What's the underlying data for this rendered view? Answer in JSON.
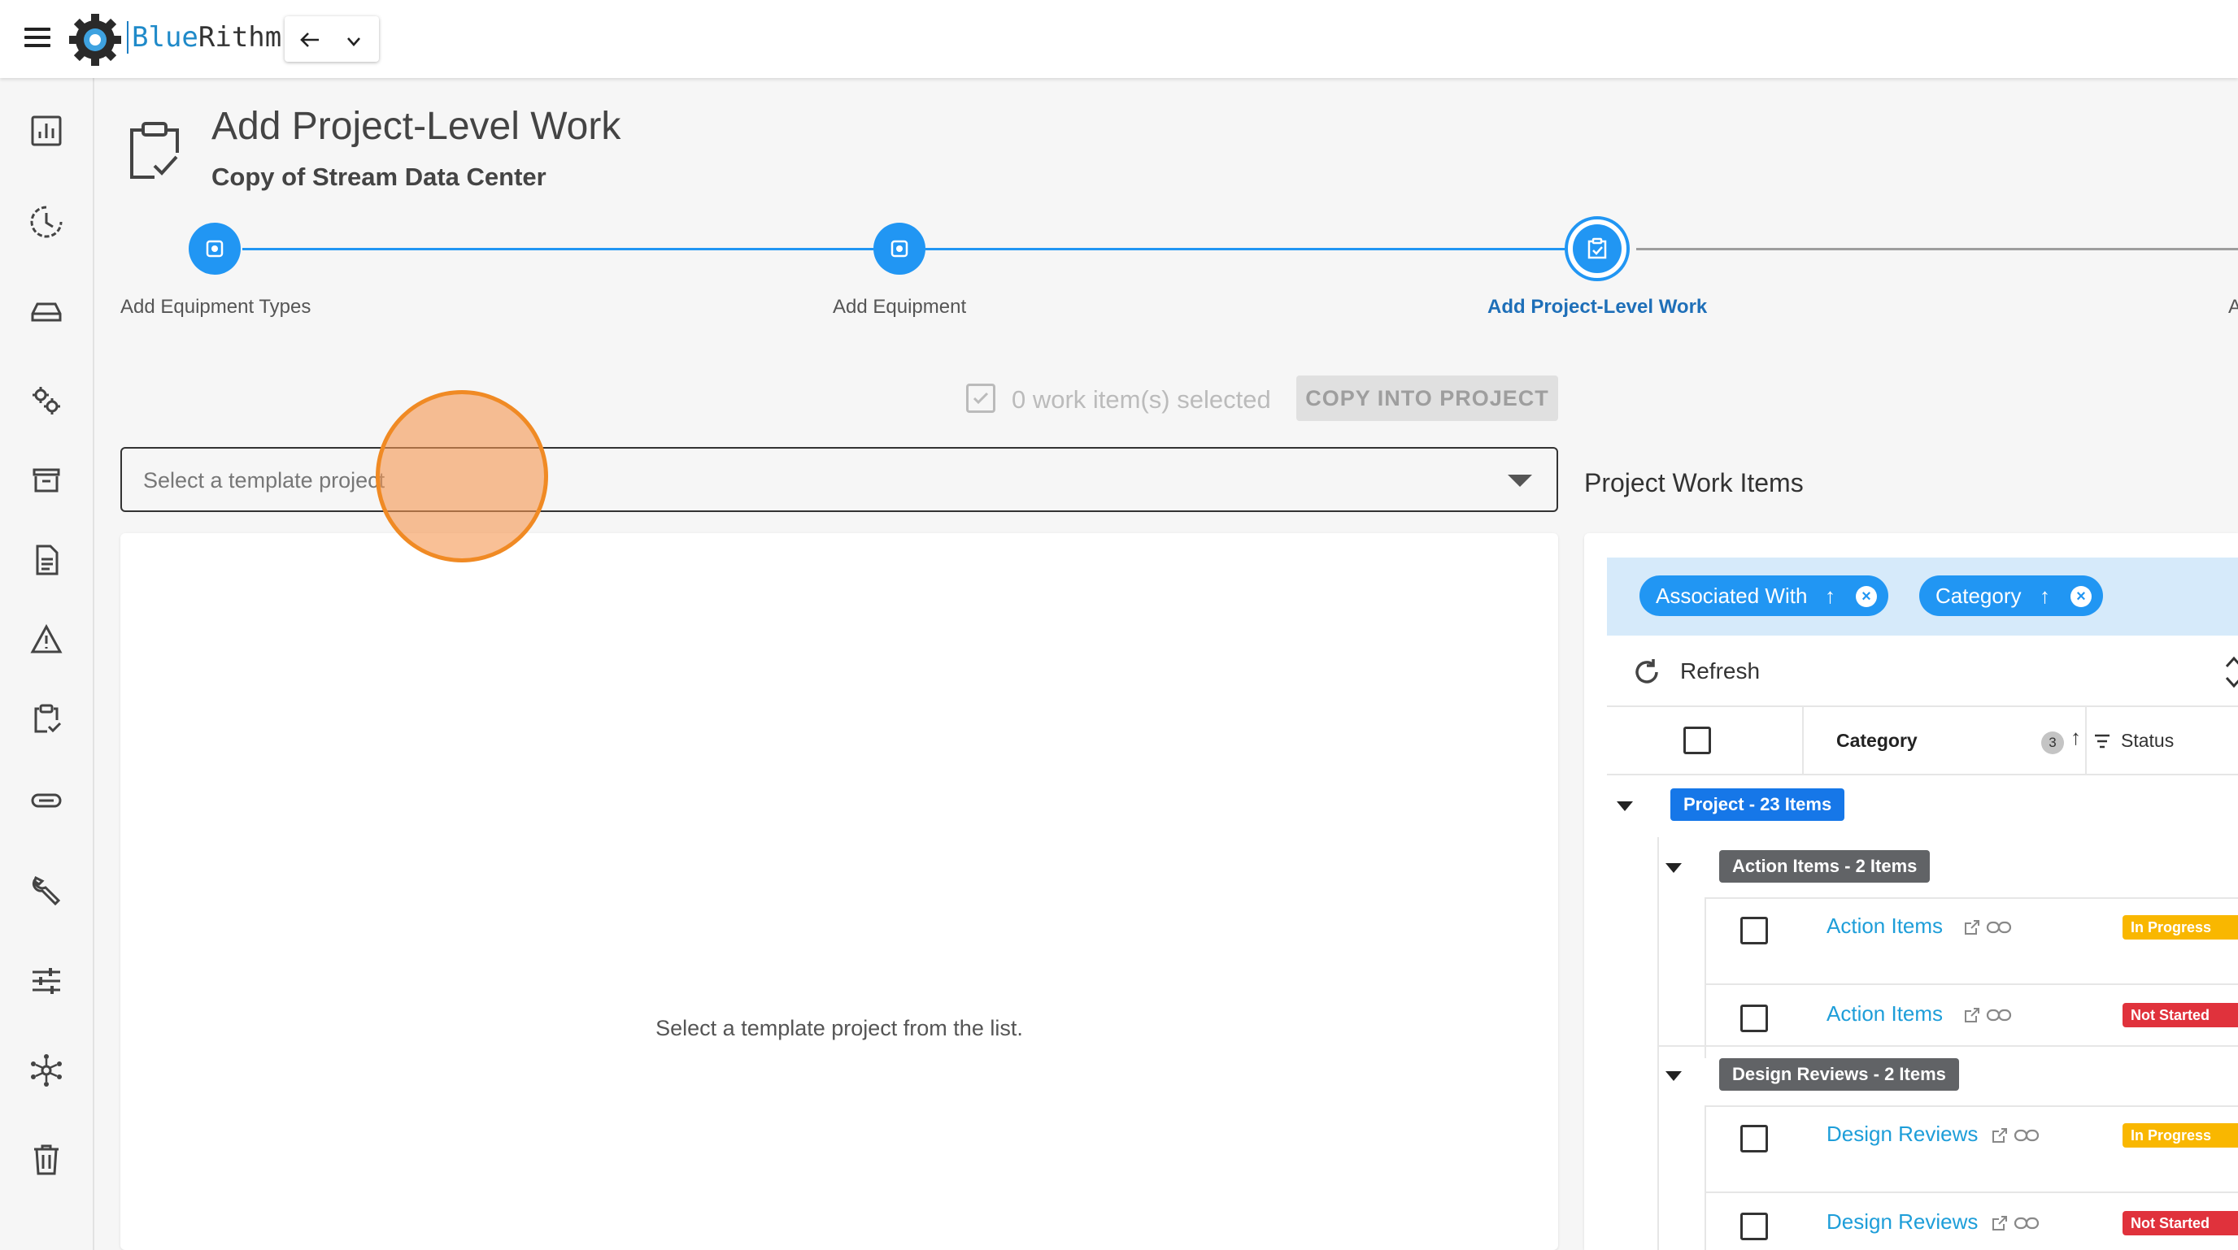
{
  "app": {
    "brand_blue": "Blue",
    "brand_rest": "Rithm"
  },
  "sidebar": {
    "icons": [
      "dashboard-icon",
      "clock-icon",
      "drive-icon",
      "gears-icon",
      "archive-icon",
      "document-icon",
      "warning-icon",
      "clipboard-check-icon",
      "paperclip-icon",
      "wrench-icon",
      "sliders-icon",
      "network-icon",
      "trash-icon"
    ]
  },
  "header": {
    "title": "Add Project-Level Work",
    "subtitle": "Copy of Stream Data Center"
  },
  "stepper": {
    "steps": [
      {
        "label": "Add Equipment Types",
        "state": "complete"
      },
      {
        "label": "Add Equipment",
        "state": "complete"
      },
      {
        "label": "Add Project-Level Work",
        "state": "active"
      },
      {
        "label": "A",
        "state": "pending"
      }
    ]
  },
  "selection": {
    "count_text": "0 work item(s) selected",
    "copy_button": "COPY INTO PROJECT"
  },
  "template": {
    "placeholder": "Select a template project",
    "empty_message": "Select a template project from the list."
  },
  "work_items": {
    "title": "Project Work Items",
    "group_chips": [
      {
        "label": "Associated With",
        "sort": "↑"
      },
      {
        "label": "Category",
        "sort": "↑"
      }
    ],
    "refresh_label": "Refresh",
    "columns": {
      "category": "Category",
      "category_sort_badge": "3",
      "status": "Status"
    },
    "project_group": "Project - 23 Items",
    "groups": [
      {
        "label": "Action Items - 2 Items",
        "rows": [
          {
            "name": "Action Items",
            "status": "In Progress"
          },
          {
            "name": "Action Items",
            "status": "Not Started"
          }
        ]
      },
      {
        "label": "Design Reviews - 2 Items",
        "rows": [
          {
            "name": "Design Reviews",
            "status": "In Progress"
          },
          {
            "name": "Design Reviews",
            "status": "Not Started"
          }
        ]
      }
    ]
  },
  "colors": {
    "primary": "#2196f3",
    "link": "#1e9ed9",
    "in_progress": "#f9b700",
    "not_started": "#e0323c",
    "group_gray": "#616366",
    "group_blue": "#1677e8",
    "cursor": "#f08a24"
  }
}
